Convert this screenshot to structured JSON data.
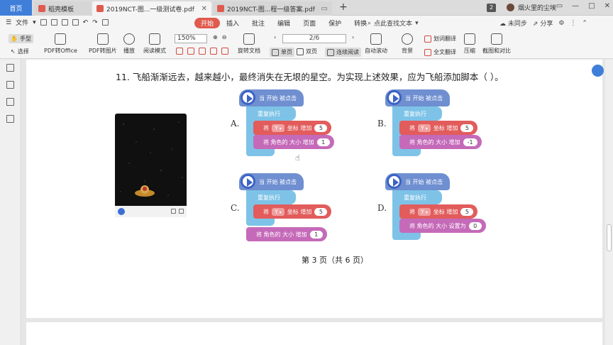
{
  "tabbar": {
    "home": "首页",
    "tabs": [
      {
        "label": "稻壳模板"
      },
      {
        "label": "2019NCT-图...一级测试卷.pdf"
      },
      {
        "label": "2019NCT-图...程一级答案.pdf"
      }
    ],
    "new_tab": "+",
    "badge_count": "2",
    "user_name": "烟火里的尘埃"
  },
  "menubar": {
    "file": "文件",
    "tabs": [
      "开始",
      "插入",
      "批注",
      "编辑",
      "页面",
      "保护",
      "转换"
    ],
    "active_tab": "开始",
    "search": "点此查找文本",
    "sync": "未同步",
    "share": "分享"
  },
  "ribbon": {
    "hand": "手型",
    "select": "选择",
    "pdf_office": "PDF转Office",
    "pdf_image": "PDF转图片",
    "play": "播放",
    "read_mode": "阅读模式",
    "zoom": "150%",
    "rotate": "旋转文档",
    "page_indicator": "2/6",
    "single": "单页",
    "double": "双页",
    "continuous": "连续阅读",
    "auto_scroll": "自动滚动",
    "background": "背景",
    "word_translate": "划词翻译",
    "full_translate": "全文翻译",
    "compress": "压缩",
    "screenshot": "截图和对比"
  },
  "document": {
    "question": "11. 飞船渐渐远去，越来越小，最终消失在无垠的星空。为实现上述效果，应为飞船添加脚本（    ）。",
    "footer": "第 3 页（共 6 页）",
    "options": [
      {
        "letter": "A.",
        "hat": "当 开始 被点击",
        "loop": "重复执行",
        "blocks": [
          {
            "prefix": "将",
            "dropdown": "Y",
            "text": "坐标 增加",
            "value": "5"
          },
          {
            "text": "将 角色的 大小 增加",
            "value": "1"
          }
        ]
      },
      {
        "letter": "B.",
        "hat": "当 开始 被点击",
        "loop": "重复执行",
        "blocks": [
          {
            "prefix": "将",
            "dropdown": "Y",
            "text": "坐标 增加",
            "value": "5"
          },
          {
            "text": "将 角色的 大小 增加",
            "value": "-1"
          }
        ]
      },
      {
        "letter": "C.",
        "hat": "当 开始 被点击",
        "loop": "重复执行",
        "blocks": [
          {
            "prefix": "将",
            "dropdown": "Y",
            "text": "坐标 增加",
            "value": "5"
          },
          {
            "text": "将 角色的 大小 增加",
            "value": "1"
          }
        ]
      },
      {
        "letter": "D.",
        "hat": "当 开始 被点击",
        "loop": "重复执行",
        "blocks": [
          {
            "prefix": "将",
            "dropdown": "Y",
            "text": "坐标 增加",
            "value": "5"
          },
          {
            "text": "将 角色的 大小 设置为",
            "value": "0"
          }
        ]
      }
    ]
  },
  "colors": {
    "accent": "#3f7fd9",
    "active_tab": "#e05b4f",
    "hat_block": "#6f8fd1",
    "loop_block": "#7ec3e7",
    "motion_block": "#e25c5c",
    "looks_block": "#c56ab9"
  }
}
